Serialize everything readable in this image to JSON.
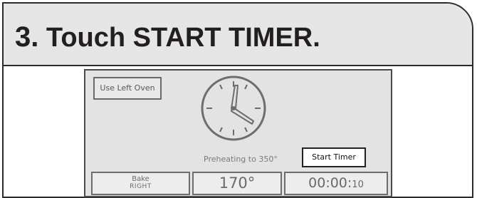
{
  "step": {
    "number": "3.",
    "instruction": "Touch START TIMER."
  },
  "screen": {
    "use_left_oven_label": "Use Left Oven",
    "status_text": "Preheating to 350°",
    "start_timer_label": "Start Timer",
    "mode": {
      "name": "Bake",
      "side": "RIGHT"
    },
    "temperature": "170°",
    "timer": {
      "main": "00:00:",
      "seconds": "10"
    }
  },
  "colors": {
    "header_bg": "#e6e6e6",
    "screen_bg": "#e3e3e3",
    "outline": "#2b2b2b"
  },
  "icons": {
    "clock": "clock-icon"
  }
}
